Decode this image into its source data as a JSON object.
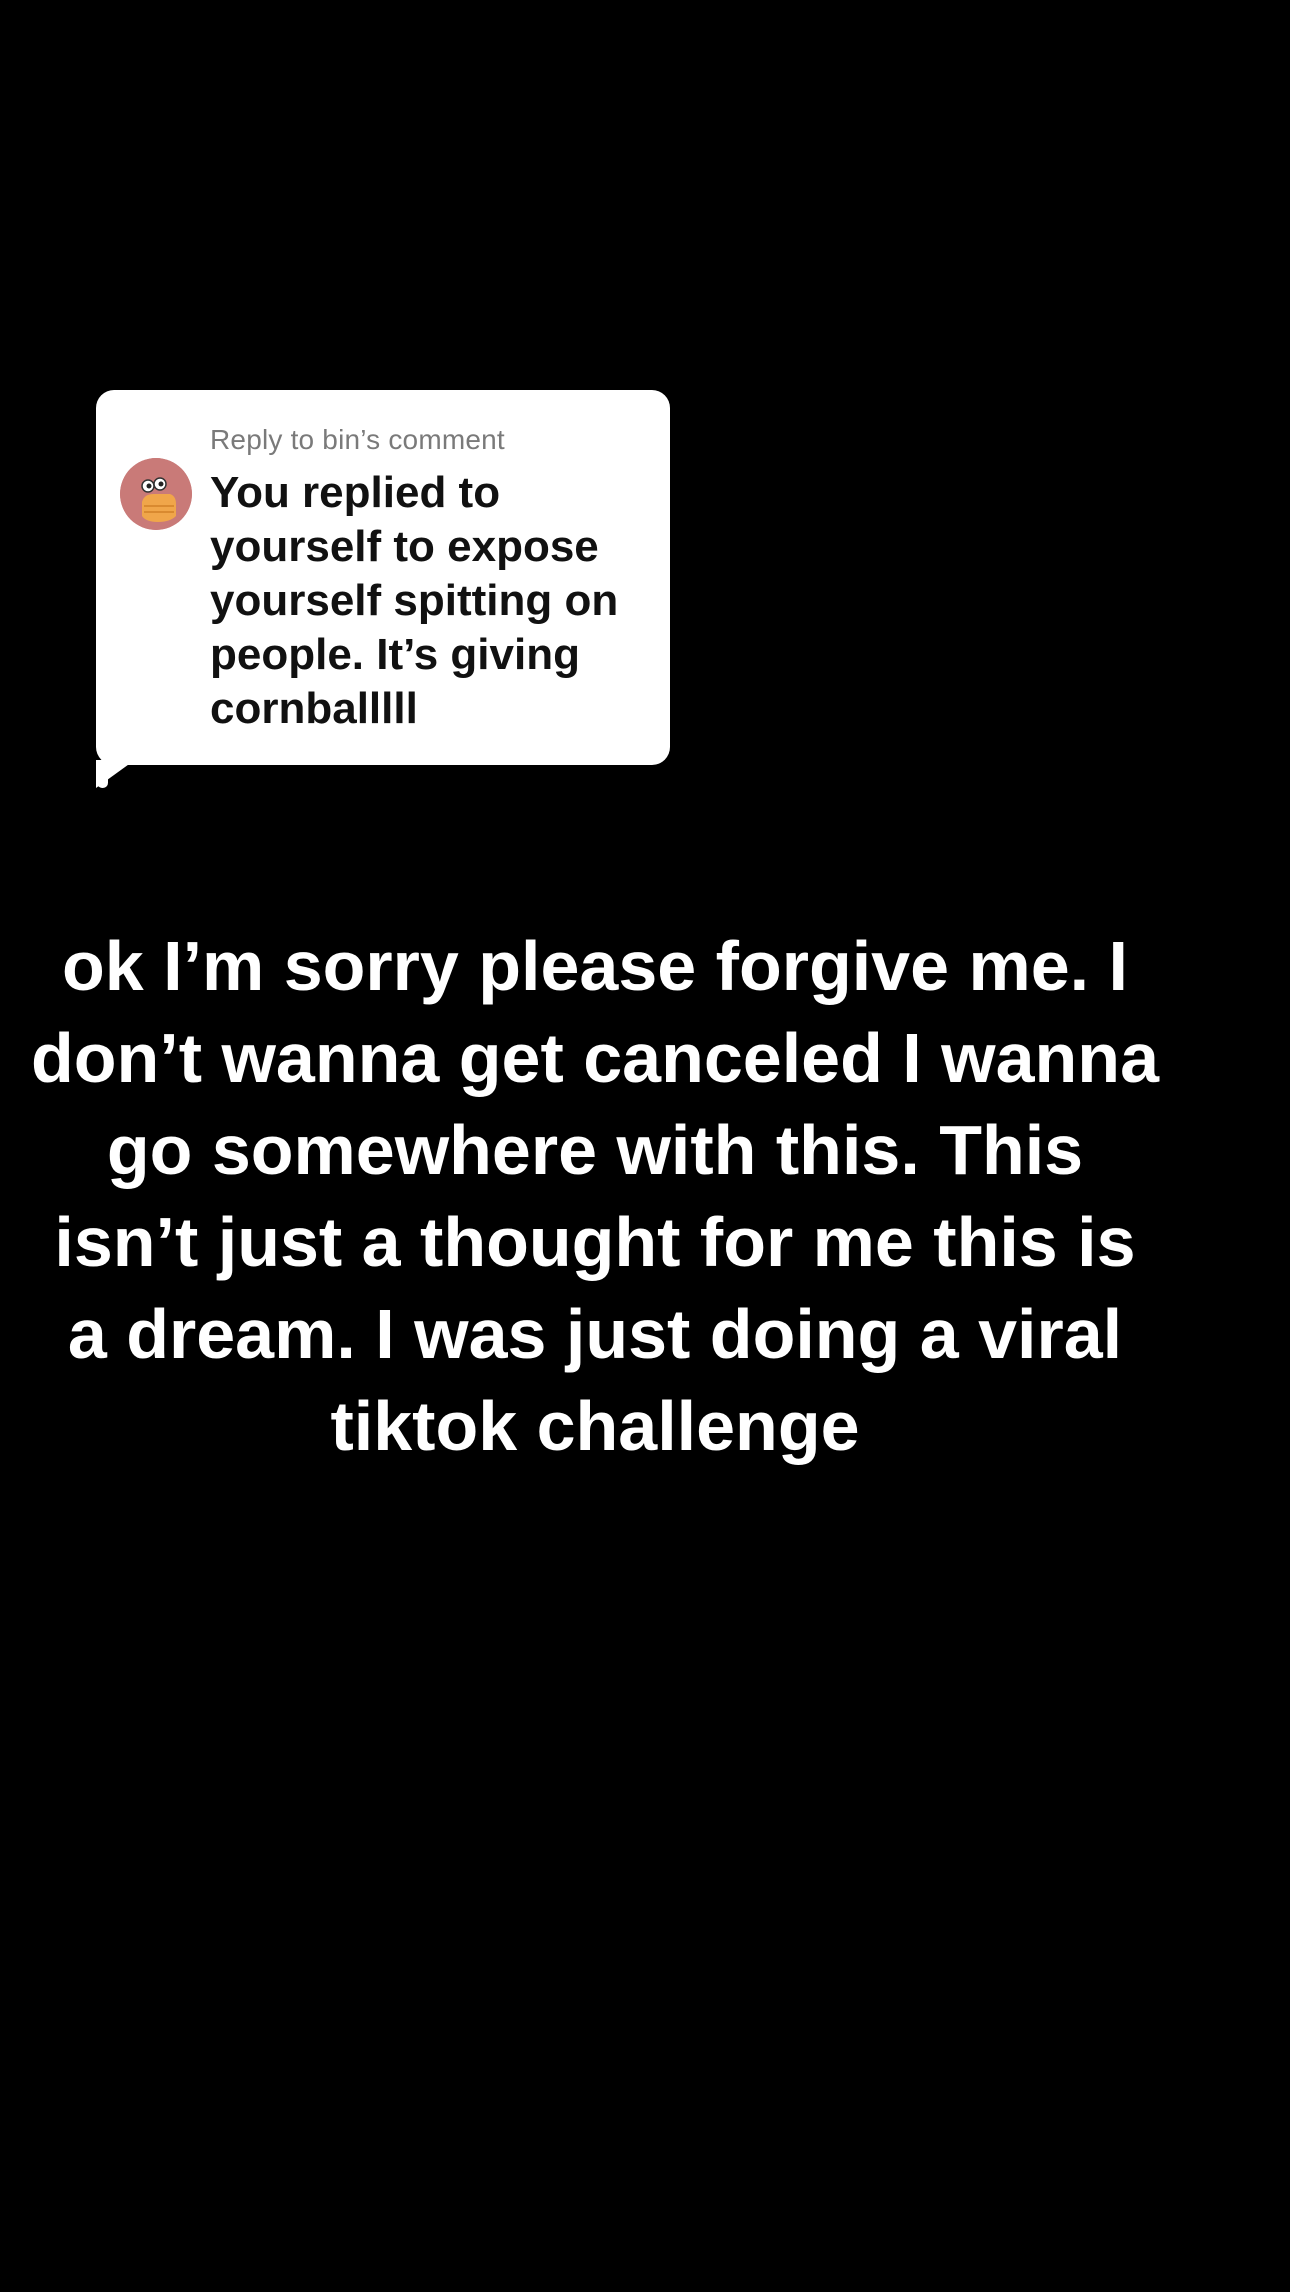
{
  "reply_card": {
    "reply_label": "Reply to bin’s comment",
    "comment_text": "You replied to yourself to expose yourself spitting on people. It’s giving cornballlll",
    "avatar_icon": "cartoon-avatar-icon",
    "avatar_bg_color": "#c97a78"
  },
  "caption": {
    "text": "ok I’m sorry please forgive me. I don’t wanna get canceled I wanna go somewhere with this. This isn’t just a thought for me this is a dream. I was just doing a viral tiktok challenge"
  },
  "colors": {
    "background": "#000000",
    "bubble": "#ffffff",
    "caption_text": "#ffffff"
  }
}
